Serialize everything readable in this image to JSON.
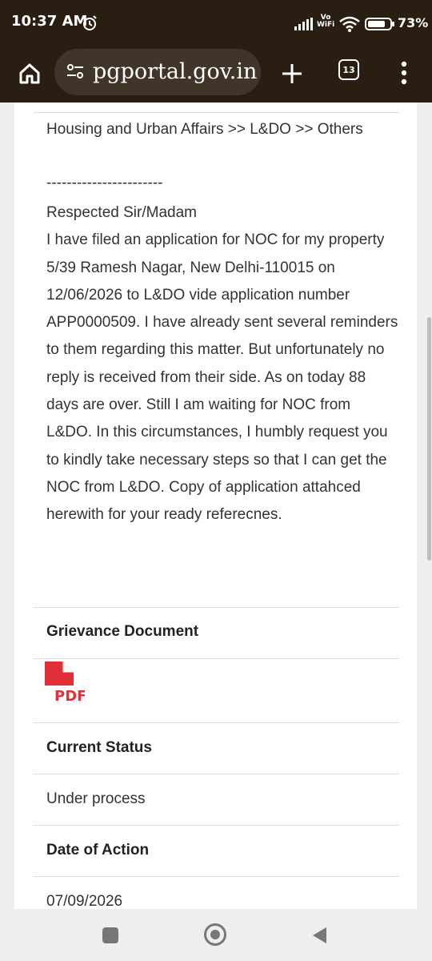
{
  "status_bar": {
    "time": "10:37 AM",
    "vowifi_top": "Vo",
    "vowifi_bottom": "WiFi",
    "battery": "73%"
  },
  "browser": {
    "url": "pgportal.gov.in",
    "tab_count": "13"
  },
  "content": {
    "category": "Housing and Urban Affairs >> L&DO >> Others",
    "separator": "-----------------------",
    "grievance_text": "Respected Sir/Madam\nI have filed an application for NOC for my property 5/39 Ramesh Nagar, New Delhi-110015 on 12/06/2026 to L&DO vide application number APP0000509. I have already sent several reminders to them regarding this matter. But unfortunately no reply is received from their side. As on today 88 days are over. Still I am waiting for NOC from L&DO. In this circumstances, I humbly request you to kindly take necessary steps so that I can get the NOC from L&DO. Copy of application attahced herewith for your ready referecnes.",
    "document_heading": "Grievance Document",
    "pdf_label": "PDF",
    "status_heading": "Current Status",
    "status_value": "Under process",
    "date_heading": "Date of Action",
    "date_value": "07/09/2026"
  },
  "colors": {
    "browser_chrome": "#2a1e12",
    "pdf_red": "#e0303a"
  }
}
